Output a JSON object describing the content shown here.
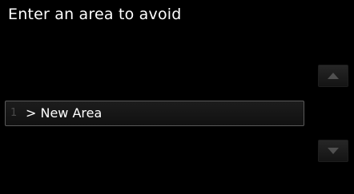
{
  "screen": {
    "title": "Enter an area to avoid"
  },
  "list": {
    "items": [
      {
        "index": "1",
        "label": "> New Area"
      }
    ]
  },
  "scroll": {
    "up_icon": "triangle-up",
    "down_icon": "triangle-down"
  },
  "colors": {
    "background": "#000000",
    "text": "#ffffff",
    "item_border": "#5a5a5a",
    "scroll_arrow": "#505050"
  }
}
